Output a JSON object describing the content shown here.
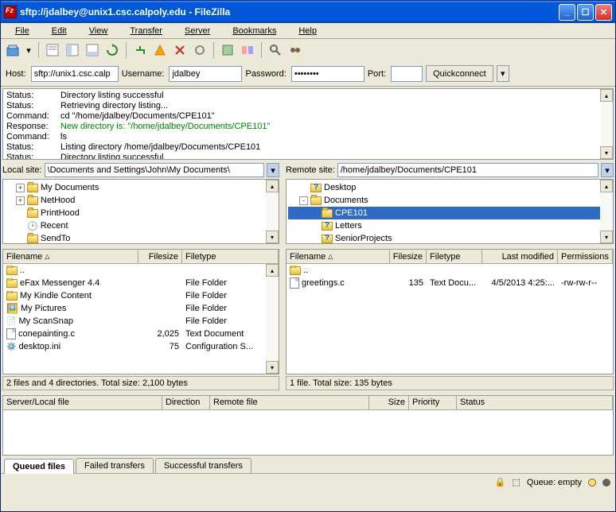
{
  "title": "sftp://jdalbey@unix1.csc.calpoly.edu - FileZilla",
  "menu": {
    "file": "File",
    "edit": "Edit",
    "view": "View",
    "transfer": "Transfer",
    "server": "Server",
    "bookmarks": "Bookmarks",
    "help": "Help"
  },
  "qc": {
    "host_label": "Host:",
    "host_value": "sftp://unix1.csc.calp",
    "user_label": "Username:",
    "user_value": "jdalbey",
    "pass_label": "Password:",
    "pass_value": "••••••••",
    "port_label": "Port:",
    "port_value": "",
    "button": "Quickconnect"
  },
  "log": [
    {
      "label": "Status:",
      "text": "Directory listing successful",
      "cls": ""
    },
    {
      "label": "Status:",
      "text": "Retrieving directory listing...",
      "cls": ""
    },
    {
      "label": "Command:",
      "text": "cd \"/home/jdalbey/Documents/CPE101\"",
      "cls": ""
    },
    {
      "label": "Response:",
      "text": "New directory is: \"/home/jdalbey/Documents/CPE101\"",
      "cls": "green"
    },
    {
      "label": "Command:",
      "text": "ls",
      "cls": ""
    },
    {
      "label": "Status:",
      "text": "Listing directory /home/jdalbey/Documents/CPE101",
      "cls": ""
    },
    {
      "label": "Status:",
      "text": "Directory listing successful",
      "cls": ""
    }
  ],
  "local": {
    "site_label": "Local site:",
    "site_value": "\\Documents and Settings\\John\\My Documents\\",
    "tree": [
      {
        "indent": 1,
        "expand": "+",
        "icon": "folder",
        "name": "My Documents"
      },
      {
        "indent": 1,
        "expand": "+",
        "icon": "folder",
        "name": "NetHood"
      },
      {
        "indent": 1,
        "expand": "",
        "icon": "folder",
        "name": "PrintHood"
      },
      {
        "indent": 1,
        "expand": "",
        "icon": "recent",
        "name": "Recent"
      },
      {
        "indent": 1,
        "expand": "",
        "icon": "folder",
        "name": "SendTo"
      }
    ],
    "cols": {
      "name": "Filename",
      "size": "Filesize",
      "type": "Filetype"
    },
    "files": [
      {
        "icon": "up",
        "name": "..",
        "size": "",
        "type": ""
      },
      {
        "icon": "folder",
        "name": "eFax Messenger 4.4",
        "size": "",
        "type": "File Folder"
      },
      {
        "icon": "folder",
        "name": "My Kindle Content",
        "size": "",
        "type": "File Folder"
      },
      {
        "icon": "pics",
        "name": "My Pictures",
        "size": "",
        "type": "File Folder"
      },
      {
        "icon": "scan",
        "name": "My ScanSnap",
        "size": "",
        "type": "File Folder"
      },
      {
        "icon": "file",
        "name": "conepainting.c",
        "size": "2,025",
        "type": "Text Document"
      },
      {
        "icon": "cfg",
        "name": "desktop.ini",
        "size": "75",
        "type": "Configuration S..."
      }
    ],
    "status": "2 files and 4 directories. Total size: 2,100 bytes"
  },
  "remote": {
    "site_label": "Remote site:",
    "site_value": "/home/jdalbey/Documents/CPE101",
    "tree": [
      {
        "indent": 1,
        "expand": "",
        "icon": "help",
        "name": "Desktop",
        "sel": false
      },
      {
        "indent": 1,
        "expand": "-",
        "icon": "folder",
        "name": "Documents",
        "sel": false
      },
      {
        "indent": 2,
        "expand": "",
        "icon": "folder",
        "name": "CPE101",
        "sel": true
      },
      {
        "indent": 2,
        "expand": "",
        "icon": "help",
        "name": "Letters",
        "sel": false
      },
      {
        "indent": 2,
        "expand": "",
        "icon": "help",
        "name": "SeniorProjects",
        "sel": false
      }
    ],
    "cols": {
      "name": "Filename",
      "size": "Filesize",
      "type": "Filetype",
      "mod": "Last modified",
      "perm": "Permissions"
    },
    "files": [
      {
        "icon": "up",
        "name": "..",
        "size": "",
        "type": "",
        "mod": "",
        "perm": ""
      },
      {
        "icon": "file",
        "name": "greetings.c",
        "size": "135",
        "type": "Text Docu...",
        "mod": "4/5/2013 4:25:...",
        "perm": "-rw-rw-r--"
      }
    ],
    "status": "1 file. Total size: 135 bytes"
  },
  "queue": {
    "cols": {
      "server": "Server/Local file",
      "dir": "Direction",
      "remote": "Remote file",
      "size": "Size",
      "prio": "Priority",
      "status": "Status"
    },
    "tabs": {
      "queued": "Queued files",
      "failed": "Failed transfers",
      "success": "Successful transfers"
    }
  },
  "statusbar": {
    "queue": "Queue: empty"
  }
}
